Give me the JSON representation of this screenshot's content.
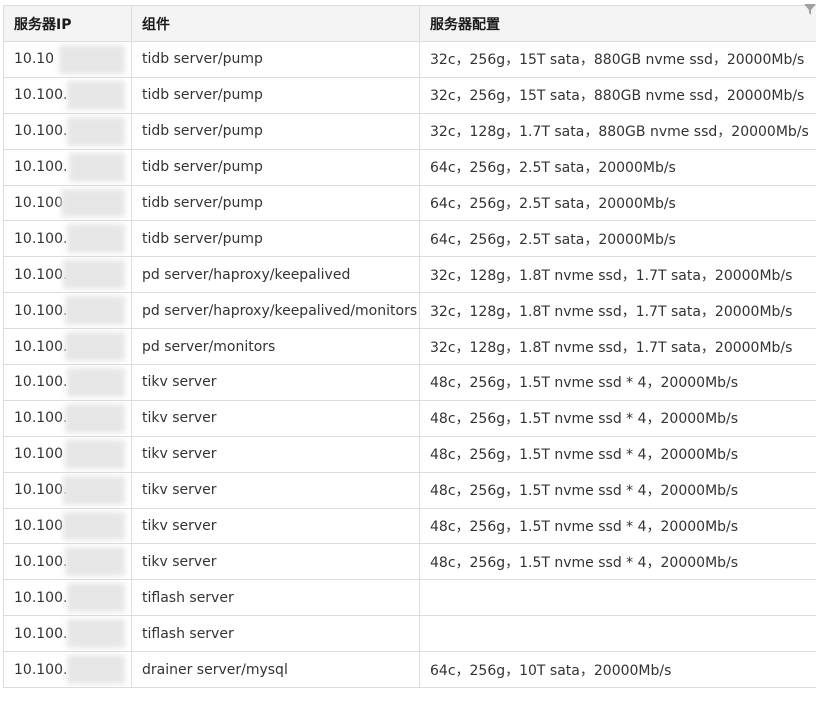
{
  "table": {
    "headers": [
      "服务器IP",
      "组件",
      "服务器配置"
    ],
    "rows": [
      {
        "ip": "10.10",
        "component": "tidb server/pump",
        "config": "32c，256g，15T sata，880GB nvme ssd，20000Mb/s"
      },
      {
        "ip": "10.100.",
        "component": "tidb server/pump",
        "config": "32c，256g，15T sata，880GB nvme ssd，20000Mb/s"
      },
      {
        "ip": "10.100.",
        "component": "tidb server/pump",
        "config": "32c，128g，1.7T sata，880GB nvme ssd，20000Mb/s"
      },
      {
        "ip": "10.100.",
        "component": "tidb server/pump",
        "config": "64c，256g，2.5T sata，20000Mb/s"
      },
      {
        "ip": "10.100",
        "component": "tidb server/pump",
        "config": "64c，256g，2.5T sata，20000Mb/s"
      },
      {
        "ip": "10.100.",
        "component": "tidb server/pump",
        "config": "64c，256g，2.5T sata，20000Mb/s"
      },
      {
        "ip": "10.100.",
        "component": "pd server/haproxy/keepalived",
        "config": "32c，128g，1.8T nvme ssd，1.7T sata，20000Mb/s"
      },
      {
        "ip": "10.100.",
        "component": "pd server/haproxy/keepalived/monitors",
        "config": "32c，128g，1.8T nvme ssd，1.7T sata，20000Mb/s"
      },
      {
        "ip": "10.100.",
        "component": "pd server/monitors",
        "config": "32c，128g，1.8T nvme ssd，1.7T sata，20000Mb/s"
      },
      {
        "ip": "10.100.",
        "component": "tikv server",
        "config": "48c，256g，1.5T nvme ssd * 4，20000Mb/s"
      },
      {
        "ip": "10.100.",
        "component": "tikv server",
        "config": "48c，256g，1.5T nvme ssd * 4，20000Mb/s"
      },
      {
        "ip": "10.100",
        "component": "tikv server",
        "config": "48c，256g，1.5T nvme ssd * 4，20000Mb/s"
      },
      {
        "ip": "10.100.",
        "component": "tikv server",
        "config": "48c，256g，1.5T nvme ssd * 4，20000Mb/s"
      },
      {
        "ip": "10.100",
        "component": "tikv server",
        "config": "48c，256g，1.5T nvme ssd * 4，20000Mb/s"
      },
      {
        "ip": "10.100.",
        "component": "tikv server",
        "config": "48c，256g，1.5T nvme ssd * 4，20000Mb/s"
      },
      {
        "ip": "10.100.",
        "component": "tiflash server",
        "config": ""
      },
      {
        "ip": "10.100.",
        "component": "tiflash server",
        "config": ""
      },
      {
        "ip": "10.100.",
        "component": "drainer server/mysql",
        "config": "64c，256g，10T sata，20000Mb/s"
      }
    ]
  },
  "icons": {
    "filter": "filter-icon",
    "filter_color": "#a0a0a0"
  },
  "colors": {
    "header_bg": "#f4f4f4",
    "border": "#dcdcdc",
    "text": "#333333",
    "mask": "#e6e6e6"
  }
}
